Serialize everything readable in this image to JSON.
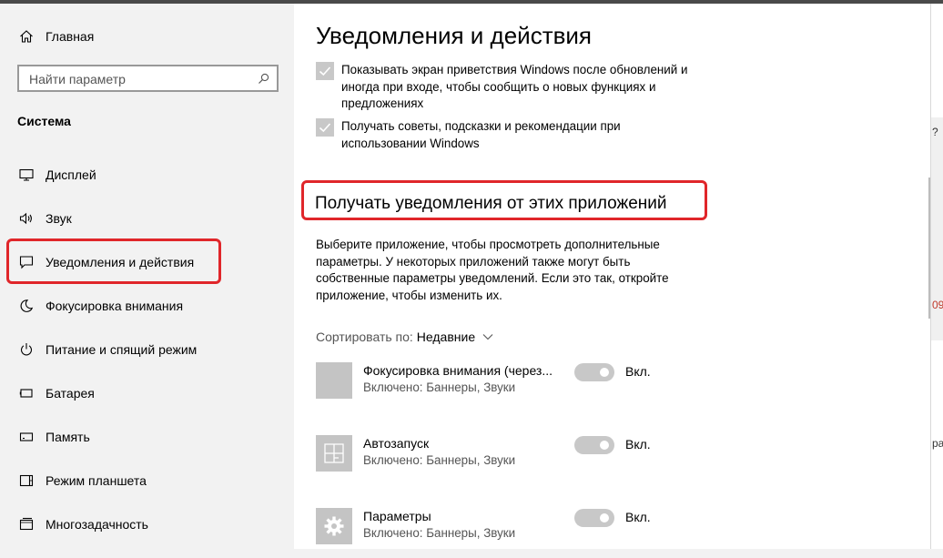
{
  "sidebar": {
    "home_label": "Главная",
    "search_placeholder": "Найти параметр",
    "section": "Система",
    "items": [
      {
        "label": "Дисплей",
        "icon": "monitor-icon"
      },
      {
        "label": "Звук",
        "icon": "speaker-icon"
      },
      {
        "label": "Уведомления и действия",
        "icon": "notification-icon"
      },
      {
        "label": "Фокусировка внимания",
        "icon": "moon-icon"
      },
      {
        "label": "Питание и спящий режим",
        "icon": "power-icon"
      },
      {
        "label": "Батарея",
        "icon": "battery-icon"
      },
      {
        "label": "Память",
        "icon": "storage-icon"
      },
      {
        "label": "Режим планшета",
        "icon": "tablet-icon"
      },
      {
        "label": "Многозадачность",
        "icon": "multitasking-icon"
      }
    ]
  },
  "main": {
    "title": "Уведомления и действия",
    "checkboxes": [
      {
        "text": "Показывать экран приветствия Windows после обновлений и иногда при входе, чтобы сообщить о новых функциях и предложениях",
        "checked": true
      },
      {
        "text": "Получать советы, подсказки и рекомендации при использовании Windows",
        "checked": true
      }
    ],
    "section_title": "Получать уведомления от этих приложений",
    "description": "Выберите приложение, чтобы просмотреть дополнительные параметры. У некоторых приложений также могут быть собственные параметры уведомлений. Если это так, откройте приложение, чтобы изменить их.",
    "sort_label": "Сортировать по:",
    "sort_value": "Недавние",
    "apps": [
      {
        "name": "Фокусировка внимания (через...",
        "status": "Включено: Баннеры, Звуки",
        "toggle": "Вкл.",
        "icon": "blank-tile-icon"
      },
      {
        "name": "Автозапуск",
        "status": "Включено: Баннеры, Звуки",
        "toggle": "Вкл.",
        "icon": "autoplay-icon"
      },
      {
        "name": "Параметры",
        "status": "Включено: Баннеры, Звуки",
        "toggle": "Вкл.",
        "icon": "gear-icon"
      }
    ]
  },
  "background_window": {
    "fragments": [
      "?",
      "09",
      "ра"
    ]
  },
  "colors": {
    "highlight": "#e0262a",
    "sidebar_bg": "#f2f2f2",
    "tile": "#c4c4c4"
  }
}
